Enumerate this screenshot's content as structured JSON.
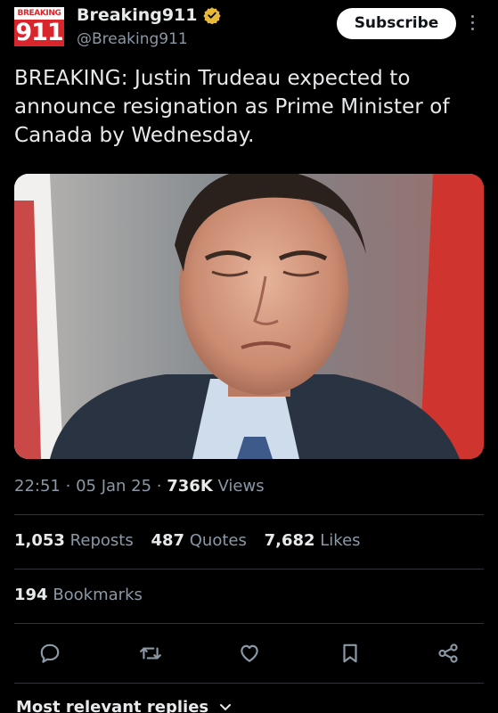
{
  "author": {
    "avatar_top": "BREAKING",
    "avatar_bottom": "911",
    "display_name": "Breaking911",
    "handle": "@Breaking911",
    "verified_color": "#e8b839"
  },
  "subscribe_label": "Subscribe",
  "tweet": {
    "text": "BREAKING: Justin Trudeau expected to announce resignation as Prime Minister of Canada by Wednesday.",
    "time": "22:51",
    "date": "05 Jan 25",
    "views_count": "736K",
    "views_label": "Views"
  },
  "stats": {
    "reposts_count": "1,053",
    "reposts_label": "Reposts",
    "quotes_count": "487",
    "quotes_label": "Quotes",
    "likes_count": "7,682",
    "likes_label": "Likes",
    "bookmarks_count": "194",
    "bookmarks_label": "Bookmarks"
  },
  "actions": [
    "reply-icon",
    "repost-icon",
    "like-icon",
    "bookmark-icon",
    "share-icon"
  ],
  "replies_sort_label": "Most relevant replies"
}
